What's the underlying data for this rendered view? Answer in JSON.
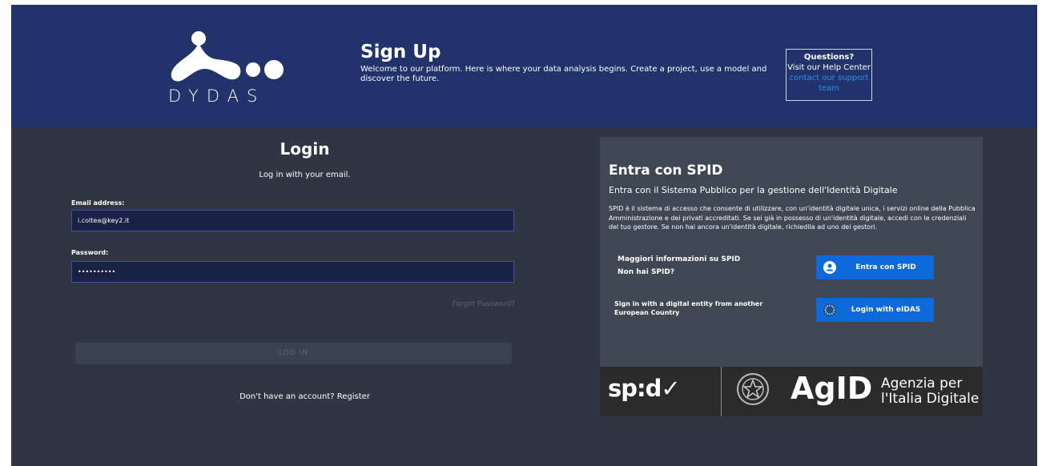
{
  "header": {
    "brand": "DYDAS",
    "title": "Sign Up",
    "welcome": "Welcome to our platform. Here is where your data analysis begins. Create a project, use a model and discover the future.",
    "questions_title": "Questions?",
    "questions_text": "Visit our Help Center",
    "questions_link": "contact our support team"
  },
  "login": {
    "title": "Login",
    "subtitle": "Log in with your email.",
    "email_label": "Email address:",
    "email_value": "i.coltea@key2.it",
    "password_label": "Password:",
    "password_value": "••••••••••",
    "forgot": "Forgot Password?",
    "button": "LOG IN",
    "register": "Don't have an account? Register"
  },
  "spid": {
    "title": "Entra con SPID",
    "subtitle": "Entra con il Sistema Pubblico per la gestione dell'Identità Digitale",
    "description": "SPID è il sistema di accesso che consente di utilizzare, con un'identità digitale unica, i servizi online della Pubblica Amministrazione e dei privati accreditati. Se sei già in possesso di un'identità digitale, accedi con le credenziali del tuo gestore. Se non hai ancora un'identità digitale, richiedila ad uno dei gestori.",
    "more_info": "Maggiori informazioni su SPID",
    "no_spid": "Non hai SPID?",
    "spid_button": "Entra con SPID",
    "eu_text": "Sign in with a digital entity from another European Country",
    "eidas_button": "Login with eIDAS"
  },
  "banner": {
    "spid_logo": "sp:d✓",
    "agid_logo": "AgID",
    "agid_line1": "Agenzia per",
    "agid_line2": "l'Italia Digitale"
  },
  "icons": {
    "spid_user": "user-icon",
    "eidas_stars": "eu-stars-icon",
    "emblem": "italian-emblem-icon"
  },
  "colors": {
    "header_bg": "#22336b",
    "page_bg": "#2f3542",
    "accent": "#0f6ad9",
    "field_bg": "#182044"
  }
}
